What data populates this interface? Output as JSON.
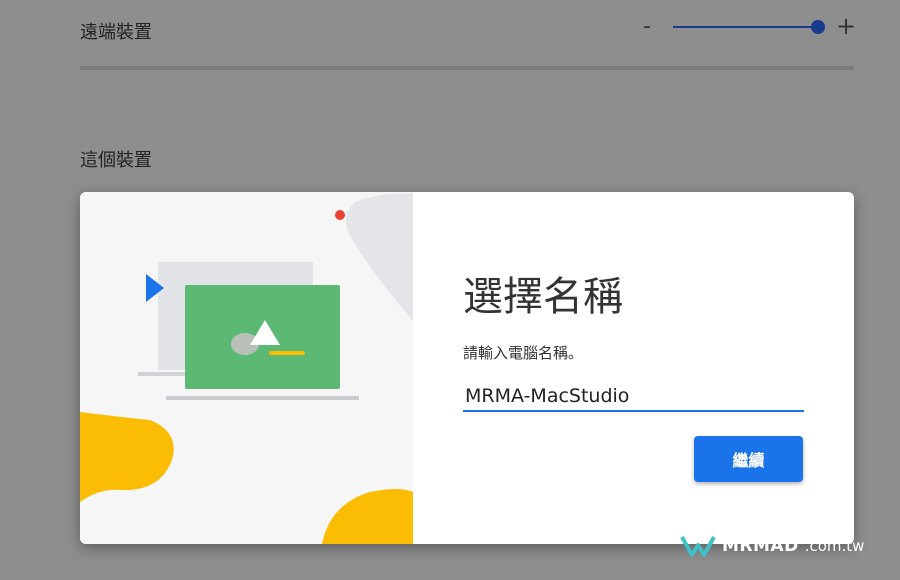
{
  "settings": {
    "remote_devices_label": "遠端裝置",
    "this_device_label": "這個裝置",
    "slider_minus": "-",
    "slider_plus": "+",
    "slider_value_fraction": 1.0
  },
  "dialog": {
    "title": "選擇名稱",
    "prompt": "請輸入電腦名稱。",
    "name_value": "MRMA-MacStudio",
    "continue_label": "繼續"
  },
  "watermark": {
    "brand": "MRMAD",
    "domain": ".com.tw"
  },
  "colors": {
    "accent": "#1a73e8",
    "slider": "#1a3a8e",
    "laptop_screen": "#5bb974",
    "yellow": "#fbbc04",
    "red_dot": "#ea4335"
  }
}
